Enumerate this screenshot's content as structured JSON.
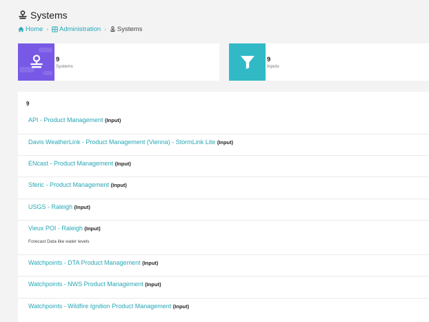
{
  "header": {
    "title": "Systems",
    "breadcrumb": [
      {
        "label": "Home"
      },
      {
        "label": "Administration"
      },
      {
        "label": "Systems"
      }
    ]
  },
  "stats": [
    {
      "count": "9",
      "label": "Systems",
      "icon": "systems-icon",
      "color": "#7859e6"
    },
    {
      "count": "9",
      "label": "Inputs",
      "icon": "filter-icon",
      "color": "#31b9c6"
    }
  ],
  "list": {
    "count": "9",
    "items": [
      {
        "name": "API - Product Management",
        "tag": "(Input)"
      },
      {
        "name": "Davis WeatherLink - Product Management (Vienna) - StormLink Lite",
        "tag": "(Input)"
      },
      {
        "name": "ENcast - Product Management",
        "tag": "(Input)"
      },
      {
        "name": "Sferic - Product Management",
        "tag": "(Input)"
      },
      {
        "name": "USGS - Raleigh",
        "tag": "(Input)"
      },
      {
        "name": "Vieux POI - Raleigh",
        "tag": "(Input)",
        "description": "Forecast Data like water levels"
      },
      {
        "name": "Watchpoints - DTA Product Management",
        "tag": "(Input)"
      },
      {
        "name": "Watchpoints - NWS Product Management",
        "tag": "(Input)"
      },
      {
        "name": "Watchpoints - Wildfire Ignition Product Management",
        "tag": "(Input)"
      }
    ]
  },
  "colors": {
    "accent": "#27a7b5",
    "purple": "#7859e6",
    "teal": "#31b9c6",
    "background": "#f3f3f4"
  }
}
